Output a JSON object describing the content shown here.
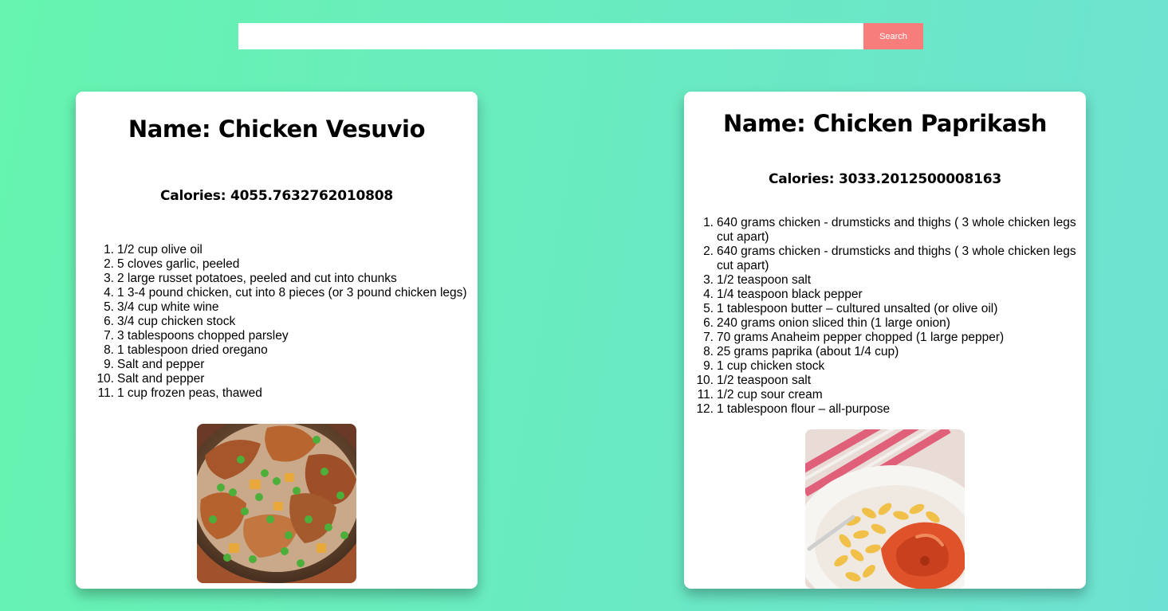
{
  "search": {
    "value": "",
    "placeholder": "",
    "button_label": "Search"
  },
  "colors": {
    "background_start": "#66f4b0",
    "background_end": "#6ee2d2",
    "search_button": "#f77d7d",
    "card": "#ffffff"
  },
  "recipes": [
    {
      "name": "Name: Chicken Vesuvio",
      "calories": "Calories: 4055.7632762010808",
      "ingredients": [
        {
          "num": "1.",
          "text": "1/2 cup olive oil"
        },
        {
          "num": "2.",
          "text": "5 cloves garlic, peeled"
        },
        {
          "num": "3.",
          "text": "2 large russet potatoes, peeled and cut into chunks"
        },
        {
          "num": "4.",
          "text": "1 3-4 pound chicken, cut into 8 pieces (or 3 pound chicken legs)"
        },
        {
          "num": "5.",
          "text": "3/4 cup white wine"
        },
        {
          "num": "6.",
          "text": "3/4 cup chicken stock"
        },
        {
          "num": "7.",
          "text": "3 tablespoons chopped parsley"
        },
        {
          "num": "8.",
          "text": "1 tablespoon dried oregano"
        },
        {
          "num": "9.",
          "text": "Salt and pepper"
        },
        {
          "num": "10.",
          "text": "Salt and pepper"
        },
        {
          "num": "11.",
          "text": "1 cup frozen peas, thawed"
        }
      ],
      "image": "chicken-vesuvio-photo"
    },
    {
      "name": "Name: Chicken Paprikash",
      "calories": "Calories: 3033.2012500008163",
      "ingredients": [
        {
          "num": "1.",
          "text": "640 grams chicken - drumsticks and thighs ( 3 whole chicken legs cut apart)"
        },
        {
          "num": "2.",
          "text": "640 grams chicken - drumsticks and thighs ( 3 whole chicken legs cut apart)"
        },
        {
          "num": "3.",
          "text": "1/2 teaspoon salt"
        },
        {
          "num": "4.",
          "text": "1/4 teaspoon black pepper"
        },
        {
          "num": "5.",
          "text": "1 tablespoon butter – cultured unsalted (or olive oil)"
        },
        {
          "num": "6.",
          "text": "240 grams onion sliced thin (1 large onion)"
        },
        {
          "num": "7.",
          "text": "70 grams Anaheim pepper chopped (1 large pepper)"
        },
        {
          "num": "8.",
          "text": "25 grams paprika (about 1/4 cup)"
        },
        {
          "num": "9.",
          "text": "1 cup chicken stock"
        },
        {
          "num": "10.",
          "text": "1/2 teaspoon salt"
        },
        {
          "num": "11.",
          "text": "1/2 cup sour cream"
        },
        {
          "num": "12.",
          "text": "1 tablespoon flour – all-purpose"
        }
      ],
      "image": "chicken-paprikash-photo"
    }
  ]
}
